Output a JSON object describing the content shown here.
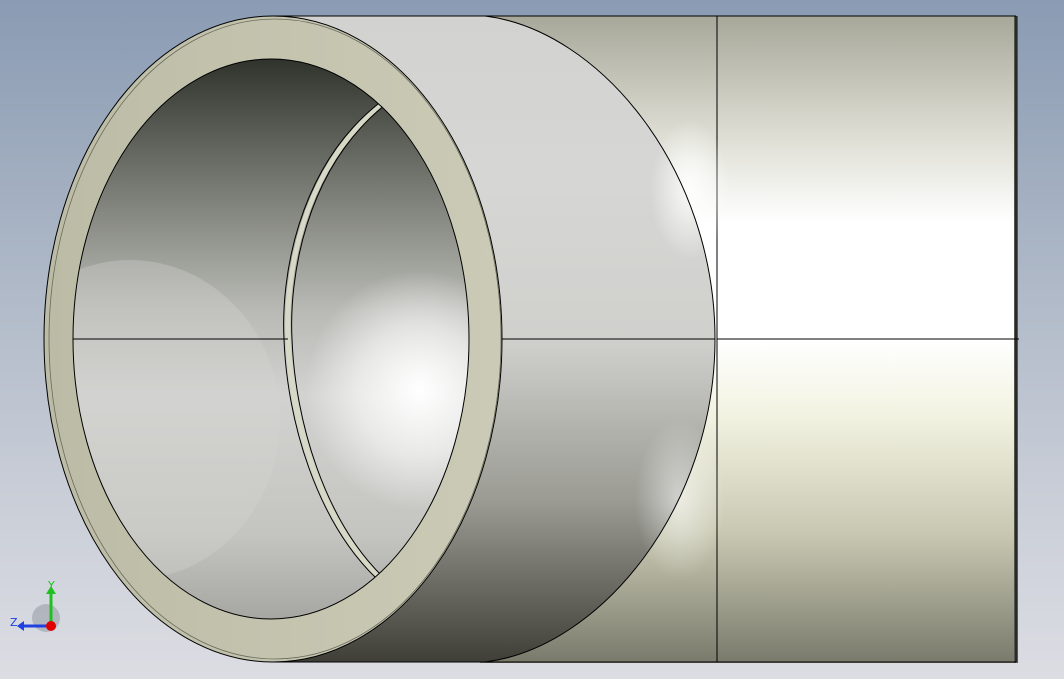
{
  "viewport": {
    "model": "pipe-tee-fitting",
    "colors": {
      "background_top": "#8a9bb3",
      "background_bottom": "#dcdde3",
      "ring_face": "#c4c4ae",
      "body_light": "#ffffff",
      "body_dark": "#3f3f38",
      "edge_line": "#000000"
    }
  },
  "triad": {
    "x_label": "",
    "y_label": "Y",
    "z_label": "Z",
    "colors": {
      "x": "#e00000",
      "y": "#20c020",
      "z": "#2040e0"
    }
  }
}
